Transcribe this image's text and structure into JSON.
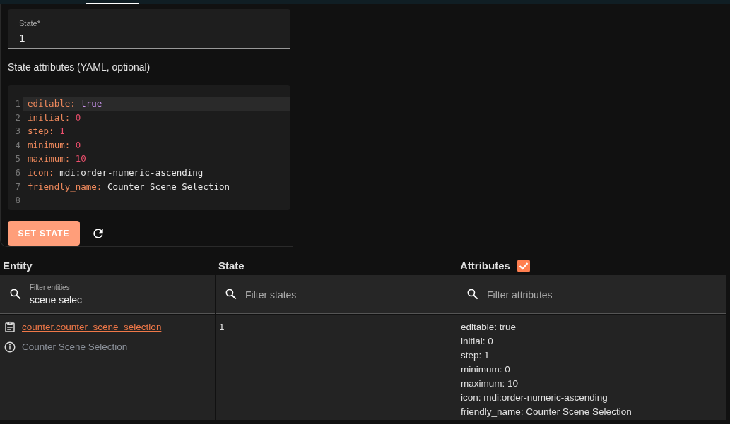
{
  "state_field": {
    "label": "State*",
    "value": "1"
  },
  "attributes_label": "State attributes (YAML, optional)",
  "editor": {
    "lines": [
      {
        "number": "1",
        "key": "editable:",
        "value": "true",
        "kind": "bool",
        "active": true
      },
      {
        "number": "2",
        "key": "initial:",
        "value": "0",
        "kind": "number",
        "active": false
      },
      {
        "number": "3",
        "key": "step:",
        "value": "1",
        "kind": "number",
        "active": false
      },
      {
        "number": "4",
        "key": "minimum:",
        "value": "0",
        "kind": "number",
        "active": false
      },
      {
        "number": "5",
        "key": "maximum:",
        "value": "10",
        "kind": "number",
        "active": false
      },
      {
        "number": "6",
        "key": "icon:",
        "value": "mdi:order-numeric-ascending",
        "kind": "string",
        "active": false
      },
      {
        "number": "7",
        "key": "friendly_name:",
        "value": "Counter Scene Selection",
        "kind": "string",
        "active": false
      },
      {
        "number": "8",
        "kind": "empty",
        "active": false
      }
    ]
  },
  "set_state_button": "SET STATE",
  "table": {
    "columns": [
      {
        "title": "Entity"
      },
      {
        "title": "State"
      },
      {
        "title": "Attributes",
        "checkbox": {
          "checked": true
        }
      }
    ],
    "filters": [
      {
        "label": "Filter entities",
        "value": "scene selec"
      },
      {
        "placeholder": "Filter states"
      },
      {
        "placeholder": "Filter attributes"
      }
    ],
    "rows": [
      {
        "entity_id": "counter.counter_scene_selection",
        "friendly_name": "Counter Scene Selection",
        "state": "1",
        "attributes": [
          "editable: true",
          "initial: 0",
          "step: 1",
          "minimum: 0",
          "maximum: 10",
          "icon: mdi:order-numeric-ascending",
          "friendly_name: Counter Scene Selection"
        ]
      }
    ]
  }
}
